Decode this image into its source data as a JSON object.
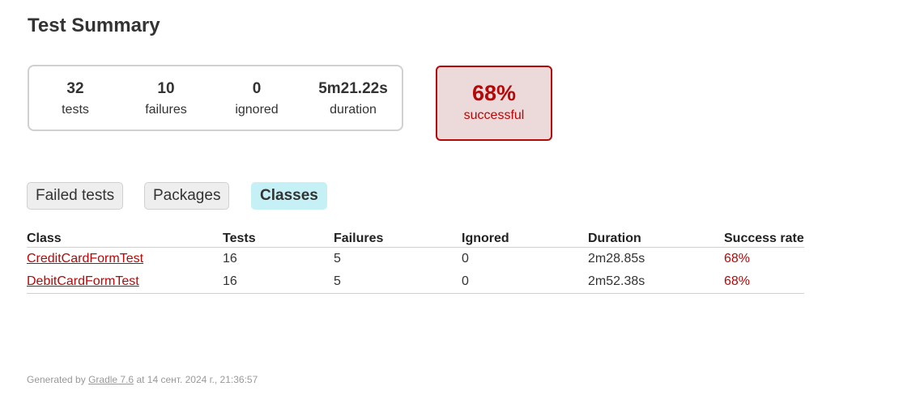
{
  "title": "Test Summary",
  "summary": {
    "tests": {
      "value": "32",
      "label": "tests"
    },
    "failures": {
      "value": "10",
      "label": "failures"
    },
    "ignored": {
      "value": "0",
      "label": "ignored"
    },
    "duration": {
      "value": "5m21.22s",
      "label": "duration"
    }
  },
  "success": {
    "rate": "68%",
    "label": "successful",
    "color": "#b60808",
    "background": "#ecdada"
  },
  "tabs": [
    {
      "label": "Failed tests",
      "active": false
    },
    {
      "label": "Packages",
      "active": false
    },
    {
      "label": "Classes",
      "active": true
    }
  ],
  "table": {
    "headers": [
      "Class",
      "Tests",
      "Failures",
      "Ignored",
      "Duration",
      "Success rate"
    ],
    "rows": [
      {
        "class": "CreditCardFormTest",
        "tests": "16",
        "failures": "5",
        "ignored": "0",
        "duration": "2m28.85s",
        "rate": "68%"
      },
      {
        "class": "DebitCardFormTest",
        "tests": "16",
        "failures": "5",
        "ignored": "0",
        "duration": "2m52.38s",
        "rate": "68%"
      }
    ]
  },
  "footer": {
    "prefix": "Generated by ",
    "link": "Gradle 7.6",
    "suffix": " at 14 сент. 2024 г., 21:36:57"
  },
  "colors": {
    "accent_fail": "#b60808",
    "active_tab": "#c5f0f5"
  }
}
